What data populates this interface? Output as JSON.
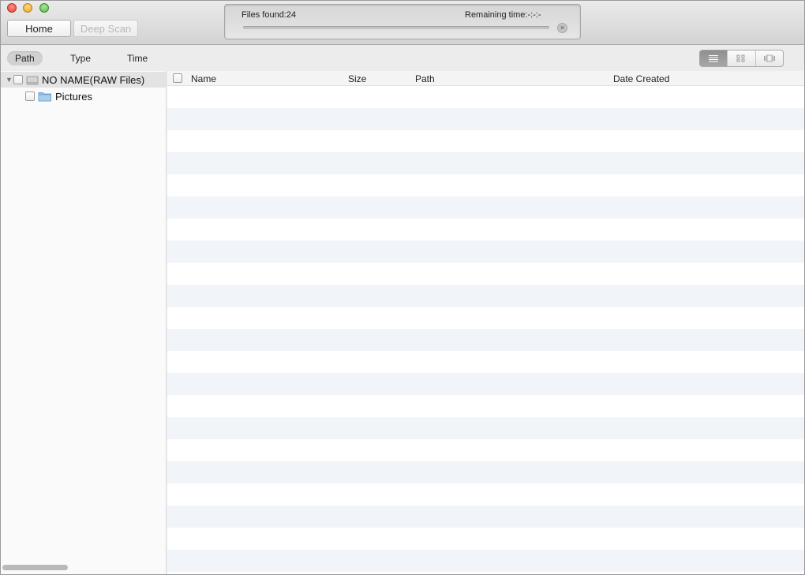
{
  "toolbar": {
    "home_label": "Home",
    "deep_scan_label": "Deep Scan"
  },
  "scan": {
    "files_found": "Files found:24",
    "remaining_time": "Remaining time:-:-:-",
    "progress": 0
  },
  "filters": {
    "tabs": [
      {
        "label": "Path",
        "active": true
      },
      {
        "label": "Type",
        "active": false
      },
      {
        "label": "Time",
        "active": false
      }
    ]
  },
  "view_modes": [
    {
      "icon": "list-view-icon",
      "active": true
    },
    {
      "icon": "grid-view-icon",
      "active": false
    },
    {
      "icon": "coverflow-view-icon",
      "active": false
    }
  ],
  "tree": {
    "root": {
      "label": "NO NAME(RAW Files)",
      "icon": "drive-icon",
      "expanded": true
    },
    "children": [
      {
        "label": "Pictures",
        "icon": "folder-icon"
      }
    ]
  },
  "table": {
    "columns": [
      "Name",
      "Size",
      "Path",
      "Date Created"
    ],
    "rows": []
  },
  "colors": {
    "row_stripe": "#f1f4f9",
    "accent": "#5b8ed6"
  }
}
